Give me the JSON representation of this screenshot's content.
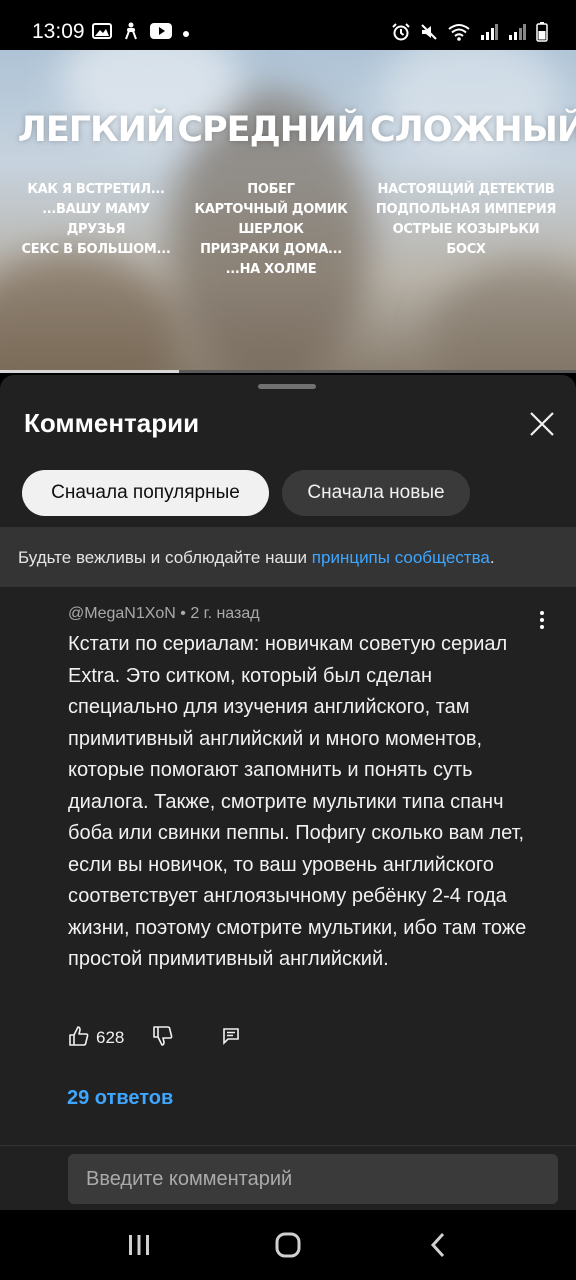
{
  "status_bar": {
    "time": "13:09",
    "left_icons": [
      "gallery-icon",
      "accessibility-icon",
      "youtube-icon",
      "dot-icon"
    ],
    "right_icons": [
      "alarm-icon",
      "mute-icon",
      "wifi-icon",
      "signal-icon",
      "signal-icon",
      "battery-icon"
    ]
  },
  "video": {
    "columns": [
      {
        "title": "ЛЕГКИЙ",
        "items": [
          "КАК Я ВСТРЕТИЛ...",
          "...ВАШУ МАМУ",
          "ДРУЗЬЯ",
          "СЕКС В БОЛЬШОМ..."
        ]
      },
      {
        "title": "СРЕДНИЙ",
        "items": [
          "ПОБЕГ",
          "КАРТОЧНЫЙ ДОМИК",
          "ШЕРЛОК",
          "ПРИЗРАКИ ДОМА...",
          "...НА ХОЛМЕ"
        ]
      },
      {
        "title": "СЛОЖНЫЙ",
        "items": [
          "НАСТОЯЩИЙ ДЕТЕКТИВ",
          "ПОДПОЛЬНАЯ ИМПЕРИЯ",
          "ОСТРЫЕ КОЗЫРЬКИ",
          "БОСХ"
        ]
      }
    ],
    "progress": 0.31
  },
  "comments_panel": {
    "title": "Комментарии",
    "close_icon": "close-icon",
    "sort_options": {
      "popular": "Сначала популярные",
      "newest": "Сначала новые",
      "selected": "popular"
    },
    "notice": {
      "text": "Будьте вежливы и соблюдайте наши ",
      "link": "принципы сообщества",
      "suffix": "."
    }
  },
  "comment": {
    "meta": "@MegaN1XoN • 2 г. назад",
    "text": "Кстати по сериалам: новичкам советую сериал Extra. Это ситком, который был сделан специально для изучения английского, там примитивный английский и много моментов, которые помогают запомнить и понять суть диалога. Также, смотрите мультики типа спанч боба или свинки пеппы. Пофигу сколько вам лет, если вы новичок, то ваш уровень английского соответствует англоязычному ребёнку 2-4 года жизни, поэтому смотрите мультики, ибо там тоже простой примитивный английский.",
    "likes": "628",
    "replies": "29 ответов"
  },
  "input": {
    "placeholder": "Введите комментарий"
  },
  "colors": {
    "background": "#212121",
    "link": "#3ea6ff",
    "chip_active": "#f1f1f1",
    "chip_inactive": "#3a3a3a"
  }
}
